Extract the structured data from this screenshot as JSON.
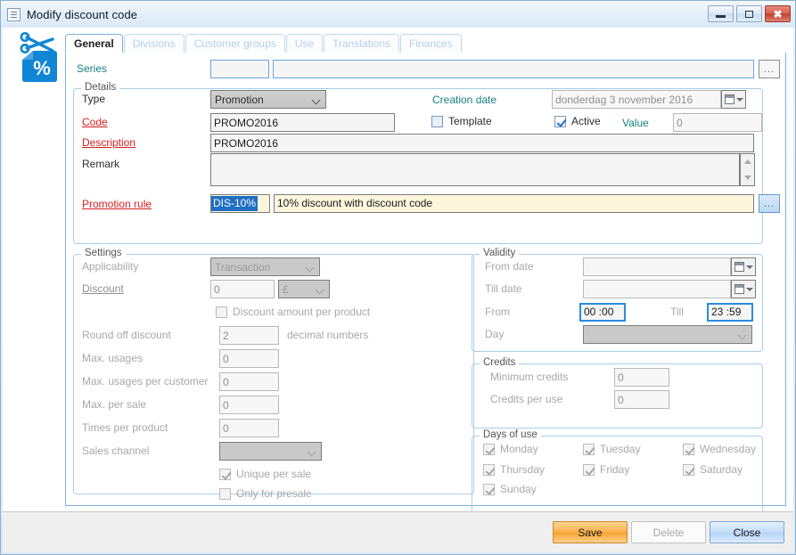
{
  "window": {
    "title": "Modify discount code",
    "icon": "document-icon",
    "controls": {
      "minimize": "minimize-icon",
      "maximize": "maximize-icon",
      "close": "✖"
    }
  },
  "app_icon": "scissors-coupon-percent-icon",
  "tabs": [
    {
      "label": "General",
      "active": true
    },
    {
      "label": "Divisions",
      "active": false
    },
    {
      "label": "Customer groups",
      "active": false
    },
    {
      "label": "Use",
      "active": false
    },
    {
      "label": "Translations",
      "active": false
    },
    {
      "label": "Finances",
      "active": false
    }
  ],
  "series": {
    "label": "Series",
    "code_value": "",
    "name_value": "",
    "browse_label": "..."
  },
  "details": {
    "legend": "Details",
    "type_label": "Type",
    "type_value": "Promotion",
    "code_label": "Code",
    "code_value": "PROMO2016",
    "description_label": "Description",
    "description_value": "PROMO2016",
    "remark_label": "Remark",
    "remark_value": "",
    "promotion_rule_label": "Promotion rule",
    "promotion_rule_code": "DIS-10%",
    "promotion_rule_text": "10% discount with discount code",
    "promotion_rule_browse": "...",
    "creation_date_label": "Creation date",
    "creation_date_value": "donderdag 3 november 2016",
    "template_label": "Template",
    "template_checked": false,
    "active_label": "Active",
    "active_checked": true,
    "value_label": "Value",
    "value_value": "0"
  },
  "settings": {
    "legend": "Settings",
    "applicability_label": "Applicability",
    "applicability_value": "Transaction",
    "discount_label": "Discount",
    "discount_value": "0",
    "discount_currency": "£",
    "discount_per_product_label": "Discount amount per product",
    "discount_per_product_checked": false,
    "round_off_label": "Round off discount",
    "round_off_value": "2",
    "round_off_suffix": "decimal numbers",
    "max_usages_label": "Max. usages",
    "max_usages_value": "0",
    "max_usages_customer_label": "Max. usages per customer",
    "max_usages_customer_value": "0",
    "max_per_sale_label": "Max. per sale",
    "max_per_sale_value": "0",
    "times_per_product_label": "Times per product",
    "times_per_product_value": "0",
    "sales_channel_label": "Sales channel",
    "sales_channel_value": "",
    "unique_per_sale_label": "Unique per sale",
    "unique_per_sale_checked": true,
    "only_presale_label": "Only for presale",
    "only_presale_checked": false
  },
  "validity": {
    "legend": "Validity",
    "from_date_label": "From date",
    "from_date_value": "",
    "till_date_label": "Till date",
    "till_date_value": "",
    "from_time_label": "From",
    "from_time_value": "00 :00",
    "till_time_label": "Till",
    "till_time_value": "23 :59",
    "day_label": "Day",
    "day_value": ""
  },
  "credits": {
    "legend": "Credits",
    "minimum_label": "Minimum credits",
    "minimum_value": "0",
    "per_use_label": "Credits per use",
    "per_use_value": "0"
  },
  "days_of_use": {
    "legend": "Days of use",
    "days": [
      {
        "label": "Monday",
        "checked": true
      },
      {
        "label": "Tuesday",
        "checked": true
      },
      {
        "label": "Wednesday",
        "checked": true
      },
      {
        "label": "Thursday",
        "checked": true
      },
      {
        "label": "Friday",
        "checked": true
      },
      {
        "label": "Saturday",
        "checked": true
      },
      {
        "label": "Sunday",
        "checked": true
      }
    ]
  },
  "footer": {
    "save_label": "Save",
    "delete_label": "Delete",
    "close_label": "Close"
  },
  "colors": {
    "accent_blue": "#1f6fc4",
    "label_red": "#d81f1f",
    "label_teal": "#17807e",
    "save_orange": "#f5a52f",
    "close_blue": "#b5d4f6",
    "highlight_blue": "#1f6fc4",
    "yellow_field": "#fdf6dd"
  }
}
